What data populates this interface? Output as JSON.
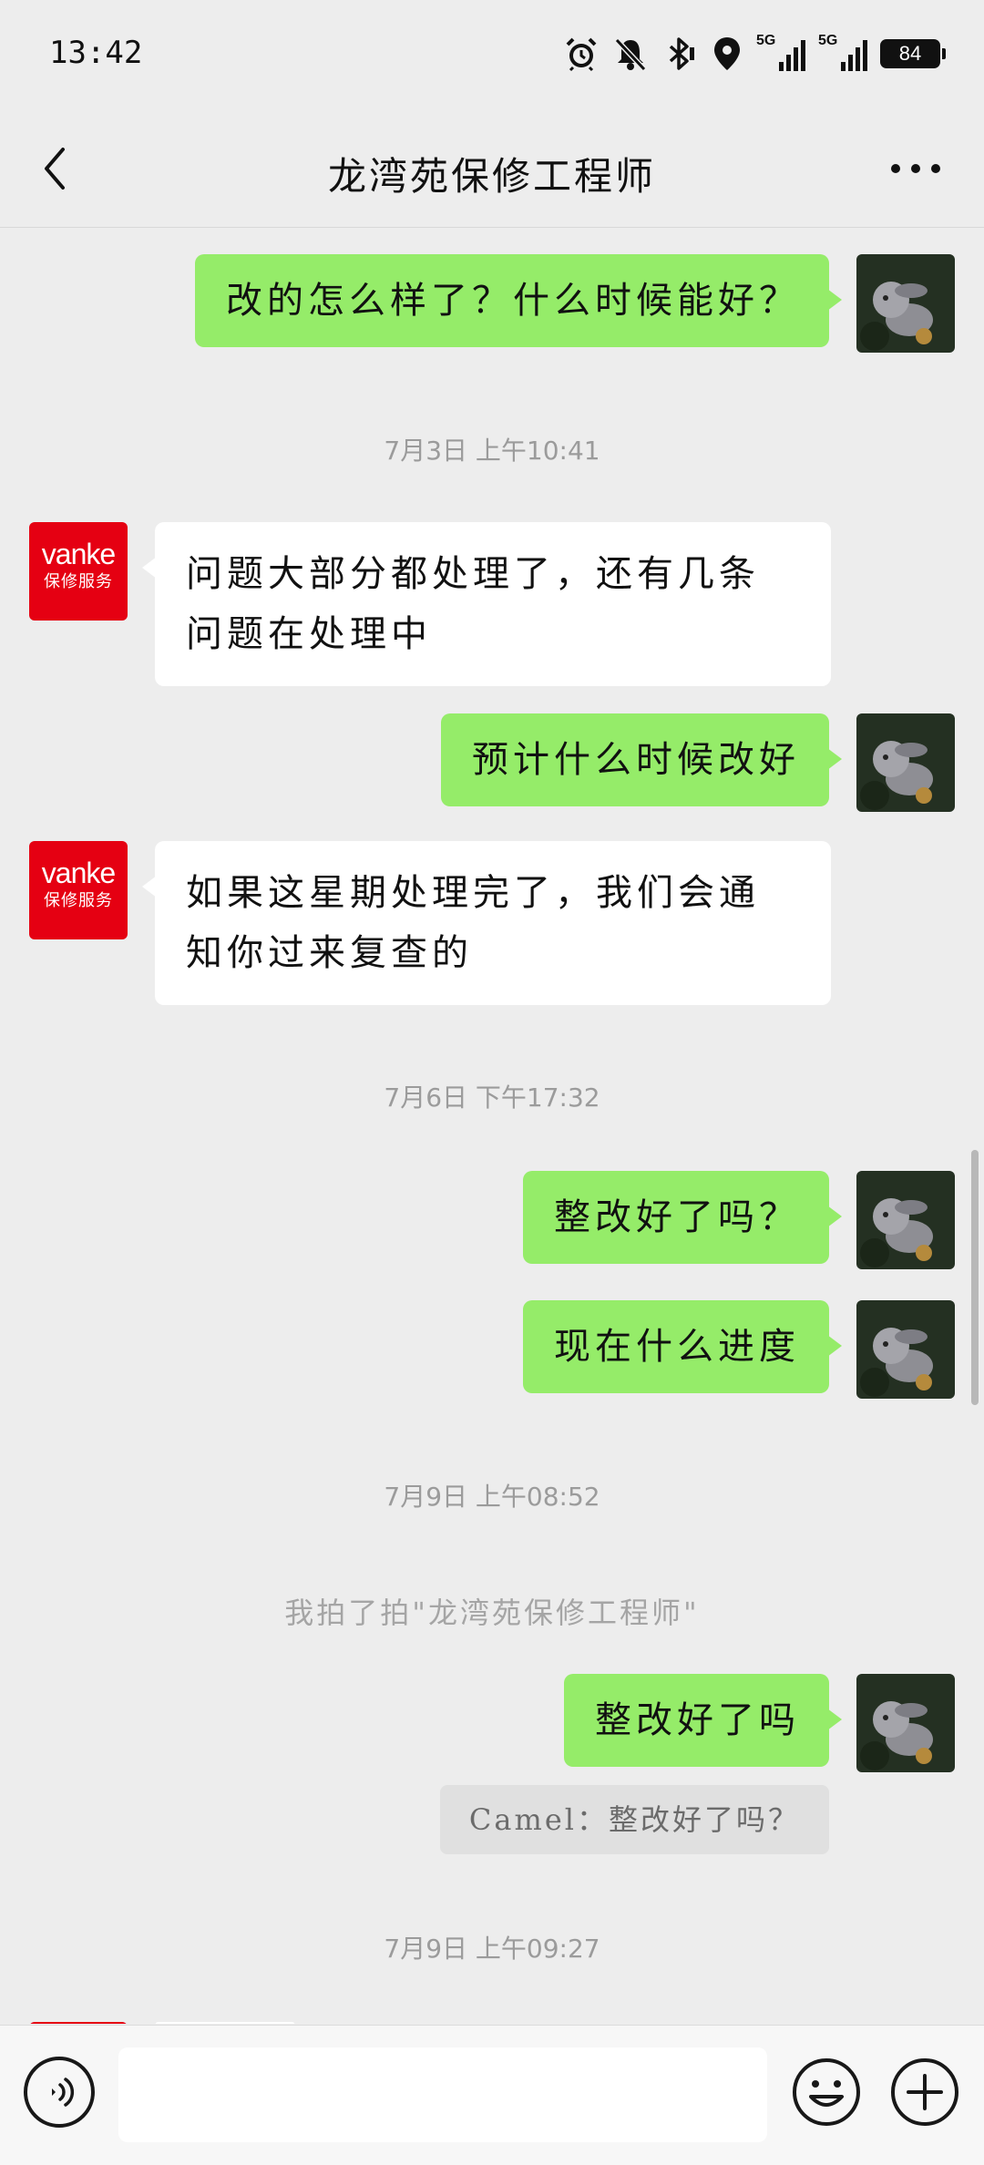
{
  "status_bar": {
    "time": "13:42",
    "icons": [
      "alarm-icon",
      "mute-bell-icon",
      "bluetooth-icon",
      "location-icon",
      "signal-5g-icon",
      "signal-5g-icon"
    ],
    "signal_1_label": "5G",
    "signal_2_label": "5G",
    "battery": "84"
  },
  "nav": {
    "title": "龙湾苑保修工程师"
  },
  "messages": [
    {
      "side": "right",
      "text": "改的怎么样了？什么时候能好？"
    },
    {
      "side": "left",
      "text": "问题大部分都处理了，还有几条问题在处理中"
    },
    {
      "side": "right",
      "text": "预计什么时候改好"
    },
    {
      "side": "left",
      "text": "如果这星期处理完了，我们会通知你过来复查的"
    },
    {
      "side": "right",
      "text": "整改好了吗？"
    },
    {
      "side": "right",
      "text": "现在什么进度"
    },
    {
      "side": "right",
      "text": "整改好了吗"
    }
  ],
  "timestamps": [
    "7月3日 上午10:41",
    "7月6日 下午17:32",
    "7月9日 上午08:52",
    "7月9日 上午09:27"
  ],
  "system_note": "我拍了拍\"龙湾苑保修工程师\"",
  "quote": "Camel：整改好了吗？",
  "vanke_avatar": {
    "line1": "vanke",
    "line2": "保修服务"
  },
  "colors": {
    "background": "#ededed",
    "self_bubble": "#95ec69",
    "other_bubble": "#ffffff",
    "vanke_red": "#e50012"
  },
  "input": {
    "placeholder": ""
  }
}
